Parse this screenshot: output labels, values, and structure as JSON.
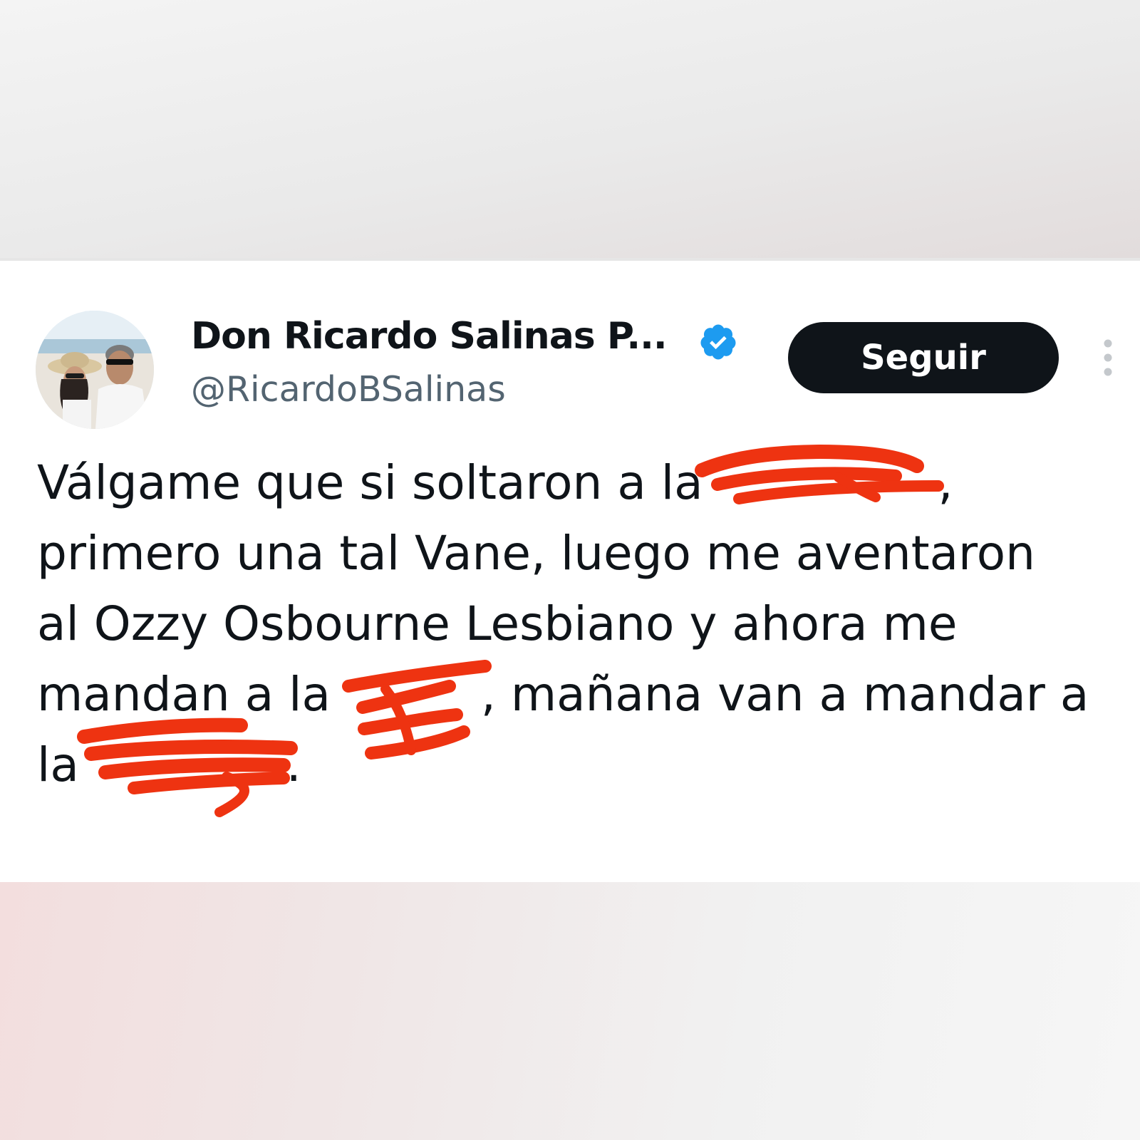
{
  "tweet": {
    "display_name": "Don Ricardo Salinas P...",
    "handle": "@RicardoBSalinas",
    "follow_label": "Seguir",
    "lines": [
      {
        "before": "Válgame que si soltaron a la",
        "after": ","
      },
      {
        "text": "primero una tal Vane, luego me aventaron"
      },
      {
        "text": "al Ozzy Osbourne Lesbiano y ahora me"
      },
      {
        "before": "mandan a la ",
        "after": ", mañana van a mandar a"
      },
      {
        "before": "la ",
        "after": "."
      }
    ]
  },
  "icons": {
    "verified": "verified-badge-icon",
    "more": "more-vertical-icon",
    "redaction_color": "#ee3311",
    "verified_color": "#1d9bf0"
  }
}
